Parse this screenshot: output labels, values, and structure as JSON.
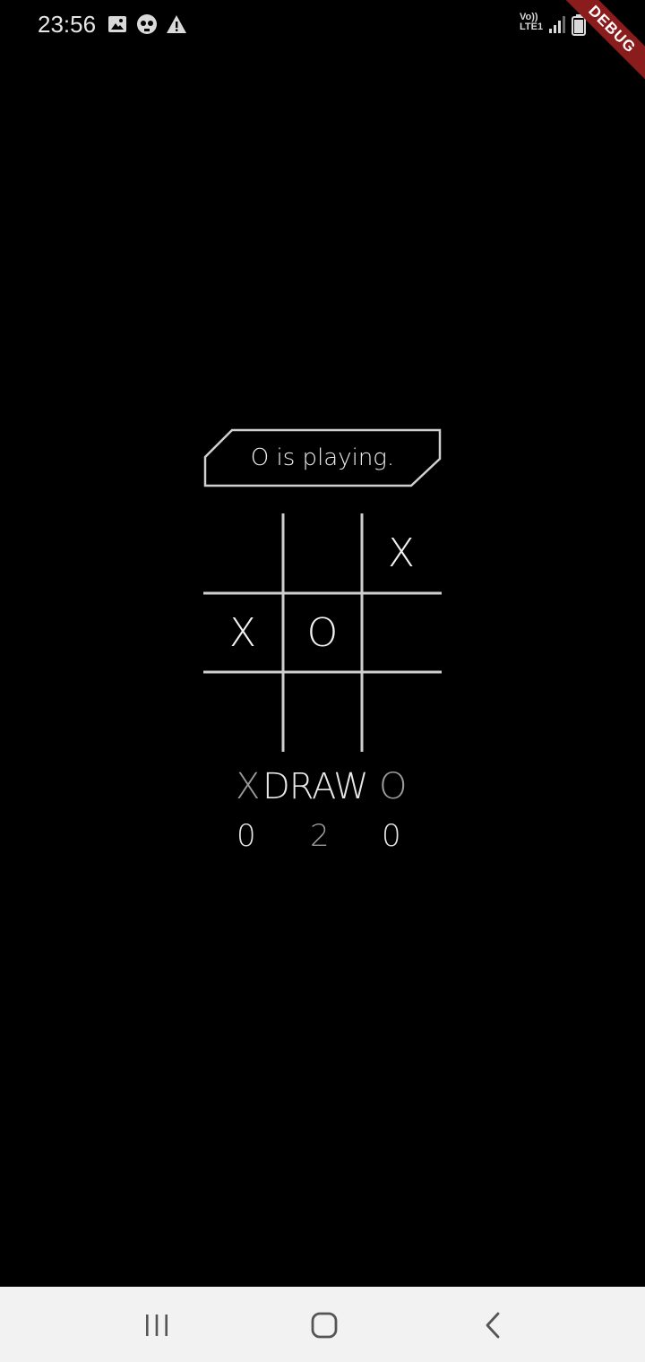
{
  "status_bar": {
    "time": "23:56",
    "icons": [
      "image-icon",
      "skull-icon",
      "warning-icon"
    ],
    "network_label_top": "Vo))",
    "network_label_bottom": "LTE1",
    "right_icons": [
      "signal-icon",
      "battery-icon"
    ]
  },
  "debug_banner": {
    "label": "DEBUG",
    "color": "#8b1c1c"
  },
  "game": {
    "status_text": "O is playing.",
    "board": [
      [
        "",
        "",
        "X"
      ],
      [
        "X",
        "O",
        ""
      ],
      [
        "",
        "",
        ""
      ]
    ],
    "scoreboard": {
      "labels": {
        "x": "X",
        "draw": "DRAW",
        "o": "O"
      },
      "values": {
        "x": "0",
        "draw": "2",
        "o": "0"
      }
    }
  },
  "nav_bar": {
    "buttons": [
      "recent-apps-icon",
      "home-icon",
      "back-icon"
    ]
  },
  "colors": {
    "background": "#000000",
    "foreground": "#eeeeee",
    "muted": "#9a9a9a",
    "nav_background": "#f2f2f2"
  }
}
